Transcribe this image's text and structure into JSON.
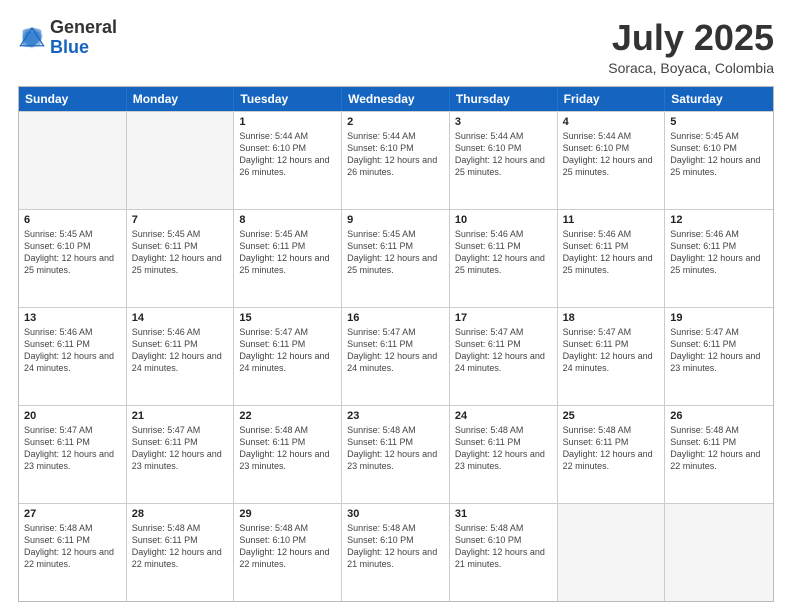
{
  "logo": {
    "general": "General",
    "blue": "Blue"
  },
  "title": "July 2025",
  "subtitle": "Soraca, Boyaca, Colombia",
  "header_days": [
    "Sunday",
    "Monday",
    "Tuesday",
    "Wednesday",
    "Thursday",
    "Friday",
    "Saturday"
  ],
  "weeks": [
    [
      {
        "day": "",
        "info": "",
        "empty": true
      },
      {
        "day": "",
        "info": "",
        "empty": true
      },
      {
        "day": "1",
        "info": "Sunrise: 5:44 AM\nSunset: 6:10 PM\nDaylight: 12 hours and 26 minutes."
      },
      {
        "day": "2",
        "info": "Sunrise: 5:44 AM\nSunset: 6:10 PM\nDaylight: 12 hours and 26 minutes."
      },
      {
        "day": "3",
        "info": "Sunrise: 5:44 AM\nSunset: 6:10 PM\nDaylight: 12 hours and 25 minutes."
      },
      {
        "day": "4",
        "info": "Sunrise: 5:44 AM\nSunset: 6:10 PM\nDaylight: 12 hours and 25 minutes."
      },
      {
        "day": "5",
        "info": "Sunrise: 5:45 AM\nSunset: 6:10 PM\nDaylight: 12 hours and 25 minutes."
      }
    ],
    [
      {
        "day": "6",
        "info": "Sunrise: 5:45 AM\nSunset: 6:10 PM\nDaylight: 12 hours and 25 minutes."
      },
      {
        "day": "7",
        "info": "Sunrise: 5:45 AM\nSunset: 6:11 PM\nDaylight: 12 hours and 25 minutes."
      },
      {
        "day": "8",
        "info": "Sunrise: 5:45 AM\nSunset: 6:11 PM\nDaylight: 12 hours and 25 minutes."
      },
      {
        "day": "9",
        "info": "Sunrise: 5:45 AM\nSunset: 6:11 PM\nDaylight: 12 hours and 25 minutes."
      },
      {
        "day": "10",
        "info": "Sunrise: 5:46 AM\nSunset: 6:11 PM\nDaylight: 12 hours and 25 minutes."
      },
      {
        "day": "11",
        "info": "Sunrise: 5:46 AM\nSunset: 6:11 PM\nDaylight: 12 hours and 25 minutes."
      },
      {
        "day": "12",
        "info": "Sunrise: 5:46 AM\nSunset: 6:11 PM\nDaylight: 12 hours and 25 minutes."
      }
    ],
    [
      {
        "day": "13",
        "info": "Sunrise: 5:46 AM\nSunset: 6:11 PM\nDaylight: 12 hours and 24 minutes."
      },
      {
        "day": "14",
        "info": "Sunrise: 5:46 AM\nSunset: 6:11 PM\nDaylight: 12 hours and 24 minutes."
      },
      {
        "day": "15",
        "info": "Sunrise: 5:47 AM\nSunset: 6:11 PM\nDaylight: 12 hours and 24 minutes."
      },
      {
        "day": "16",
        "info": "Sunrise: 5:47 AM\nSunset: 6:11 PM\nDaylight: 12 hours and 24 minutes."
      },
      {
        "day": "17",
        "info": "Sunrise: 5:47 AM\nSunset: 6:11 PM\nDaylight: 12 hours and 24 minutes."
      },
      {
        "day": "18",
        "info": "Sunrise: 5:47 AM\nSunset: 6:11 PM\nDaylight: 12 hours and 24 minutes."
      },
      {
        "day": "19",
        "info": "Sunrise: 5:47 AM\nSunset: 6:11 PM\nDaylight: 12 hours and 23 minutes."
      }
    ],
    [
      {
        "day": "20",
        "info": "Sunrise: 5:47 AM\nSunset: 6:11 PM\nDaylight: 12 hours and 23 minutes."
      },
      {
        "day": "21",
        "info": "Sunrise: 5:47 AM\nSunset: 6:11 PM\nDaylight: 12 hours and 23 minutes."
      },
      {
        "day": "22",
        "info": "Sunrise: 5:48 AM\nSunset: 6:11 PM\nDaylight: 12 hours and 23 minutes."
      },
      {
        "day": "23",
        "info": "Sunrise: 5:48 AM\nSunset: 6:11 PM\nDaylight: 12 hours and 23 minutes."
      },
      {
        "day": "24",
        "info": "Sunrise: 5:48 AM\nSunset: 6:11 PM\nDaylight: 12 hours and 23 minutes."
      },
      {
        "day": "25",
        "info": "Sunrise: 5:48 AM\nSunset: 6:11 PM\nDaylight: 12 hours and 22 minutes."
      },
      {
        "day": "26",
        "info": "Sunrise: 5:48 AM\nSunset: 6:11 PM\nDaylight: 12 hours and 22 minutes."
      }
    ],
    [
      {
        "day": "27",
        "info": "Sunrise: 5:48 AM\nSunset: 6:11 PM\nDaylight: 12 hours and 22 minutes."
      },
      {
        "day": "28",
        "info": "Sunrise: 5:48 AM\nSunset: 6:11 PM\nDaylight: 12 hours and 22 minutes."
      },
      {
        "day": "29",
        "info": "Sunrise: 5:48 AM\nSunset: 6:10 PM\nDaylight: 12 hours and 22 minutes."
      },
      {
        "day": "30",
        "info": "Sunrise: 5:48 AM\nSunset: 6:10 PM\nDaylight: 12 hours and 21 minutes."
      },
      {
        "day": "31",
        "info": "Sunrise: 5:48 AM\nSunset: 6:10 PM\nDaylight: 12 hours and 21 minutes."
      },
      {
        "day": "",
        "info": "",
        "empty": true
      },
      {
        "day": "",
        "info": "",
        "empty": true
      }
    ]
  ]
}
